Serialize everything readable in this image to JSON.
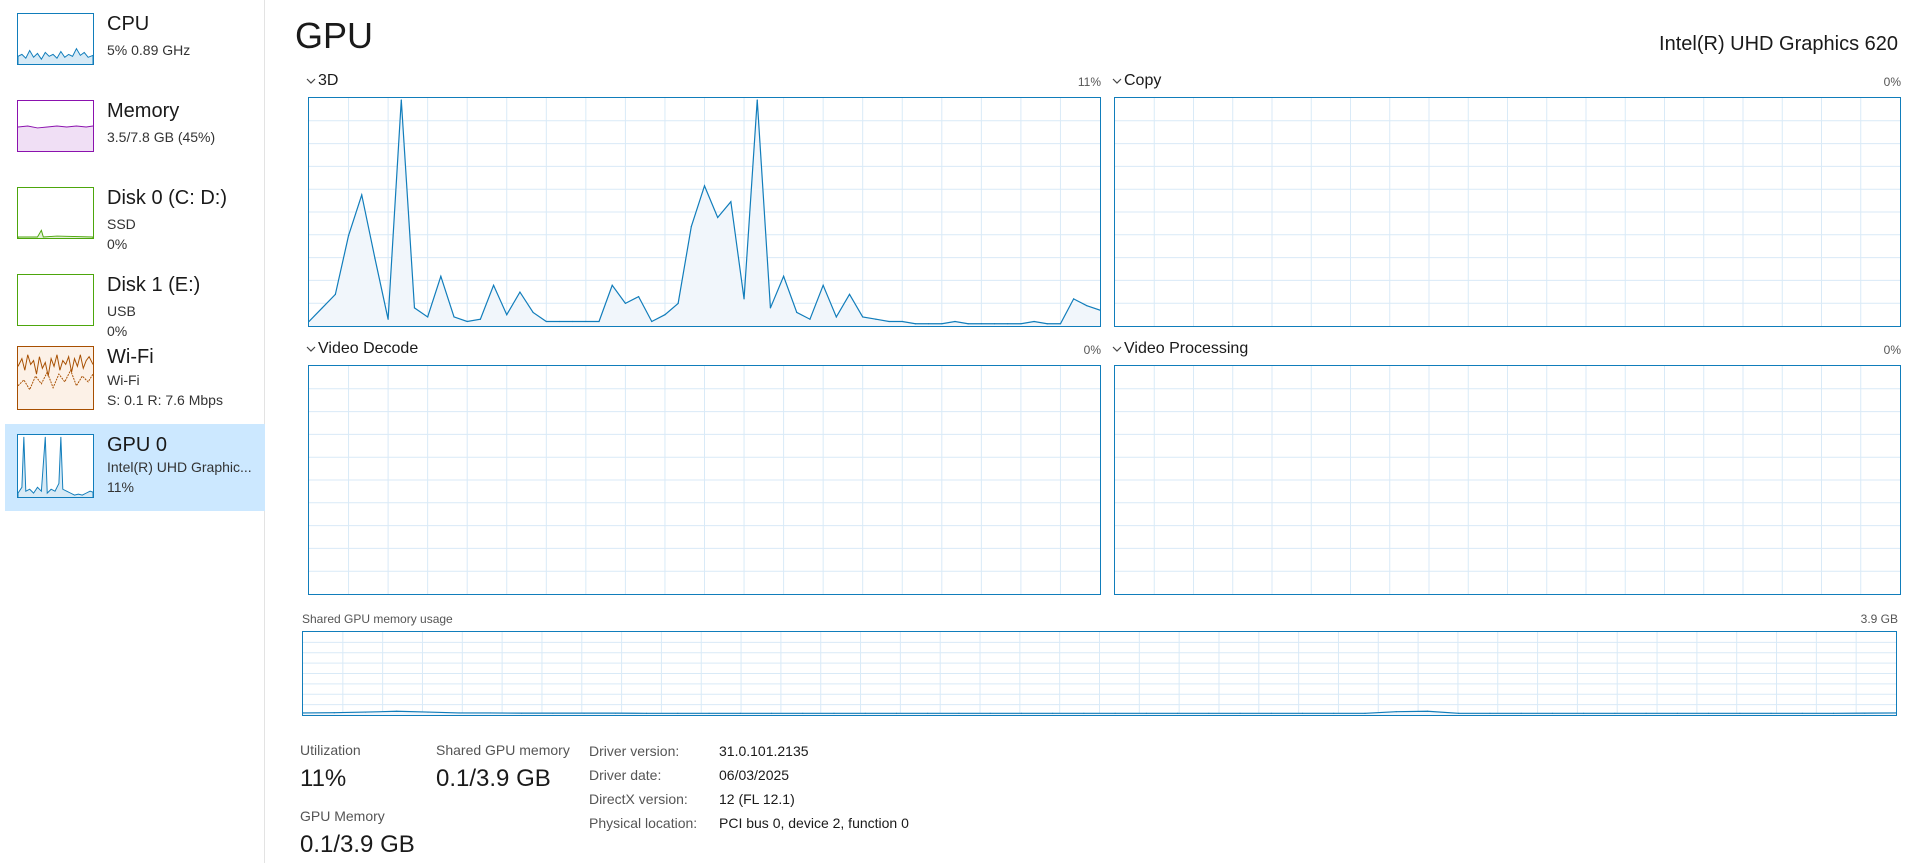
{
  "sidebar": {
    "items": [
      {
        "title": "CPU",
        "line1": "5%  0.89 GHz",
        "line2": "",
        "color": "#117dbb"
      },
      {
        "title": "Memory",
        "line1": "3.5/7.8 GB (45%)",
        "line2": "",
        "color": "#8b12ae"
      },
      {
        "title": "Disk 0 (C: D:)",
        "line1": "SSD",
        "line2": "0%",
        "color": "#4da60c"
      },
      {
        "title": "Disk 1 (E:)",
        "line1": "USB",
        "line2": "0%",
        "color": "#4da60c"
      },
      {
        "title": "Wi-Fi",
        "line1": "Wi-Fi",
        "line2": "S: 0.1  R: 7.6 Mbps",
        "color": "#a74f01"
      },
      {
        "title": "GPU 0",
        "line1": "Intel(R) UHD Graphic...",
        "line2": "11%",
        "color": "#117dbb",
        "selected": true
      }
    ]
  },
  "header": {
    "title": "GPU",
    "device": "Intel(R) UHD Graphics 620"
  },
  "graphs": {
    "3d": {
      "label": "3D",
      "percent": "11%"
    },
    "copy": {
      "label": "Copy",
      "percent": "0%"
    },
    "video_decode": {
      "label": "Video Decode",
      "percent": "0%"
    },
    "video_processing": {
      "label": "Video Processing",
      "percent": "0%"
    }
  },
  "shared_memory_graph": {
    "label": "Shared GPU memory usage",
    "max": "3.9 GB"
  },
  "stats": {
    "utilization_label": "Utilization",
    "utilization_value": "11%",
    "shared_label": "Shared GPU memory",
    "shared_value": "0.1/3.9 GB",
    "gpu_memory_label": "GPU Memory",
    "gpu_memory_value": "0.1/3.9 GB"
  },
  "details": [
    {
      "key": "Driver version:",
      "value": "31.0.101.2135"
    },
    {
      "key": "Driver date:",
      "value": "06/03/2025"
    },
    {
      "key": "DirectX version:",
      "value": "12 (FL 12.1)"
    },
    {
      "key": "Physical location:",
      "value": "PCI bus 0, device 2, function 0"
    }
  ],
  "chart_data": [
    {
      "type": "area",
      "title": "3D",
      "ylim": [
        0,
        100
      ],
      "x_points": 60,
      "values": [
        2,
        8,
        14,
        40,
        58,
        30,
        3,
        100,
        8,
        4,
        22,
        4,
        2,
        3,
        18,
        5,
        15,
        6,
        2,
        2,
        2,
        2,
        2,
        18,
        10,
        13,
        2,
        5,
        10,
        44,
        62,
        48,
        55,
        12,
        100,
        8,
        22,
        6,
        3,
        18,
        4,
        14,
        4,
        3,
        2,
        2,
        1,
        1,
        1,
        2,
        1,
        1,
        1,
        1,
        1,
        2,
        1,
        1,
        12,
        9,
        7
      ]
    },
    {
      "type": "area",
      "title": "Copy",
      "ylim": [
        0,
        100
      ],
      "values": []
    },
    {
      "type": "area",
      "title": "Video Decode",
      "ylim": [
        0,
        100
      ],
      "values": []
    },
    {
      "type": "area",
      "title": "Video Processing",
      "ylim": [
        0,
        100
      ],
      "values": []
    },
    {
      "type": "area",
      "title": "Shared GPU memory usage",
      "ylim": [
        0,
        3.9
      ],
      "values": [
        0.1,
        0.11,
        0.14,
        0.18,
        0.14,
        0.1,
        0.1,
        0.09,
        0.09,
        0.09,
        0.09,
        0.08,
        0.08,
        0.08,
        0.08,
        0.08,
        0.08,
        0.08,
        0.08,
        0.08,
        0.08,
        0.08,
        0.08,
        0.08,
        0.08,
        0.08,
        0.08,
        0.08,
        0.08,
        0.08,
        0.08,
        0.08,
        0.08,
        0.08,
        0.08,
        0.16,
        0.18,
        0.08,
        0.08,
        0.08,
        0.08,
        0.08,
        0.08,
        0.08,
        0.08,
        0.08,
        0.08,
        0.08,
        0.08,
        0.08,
        0.09,
        0.1
      ]
    }
  ]
}
